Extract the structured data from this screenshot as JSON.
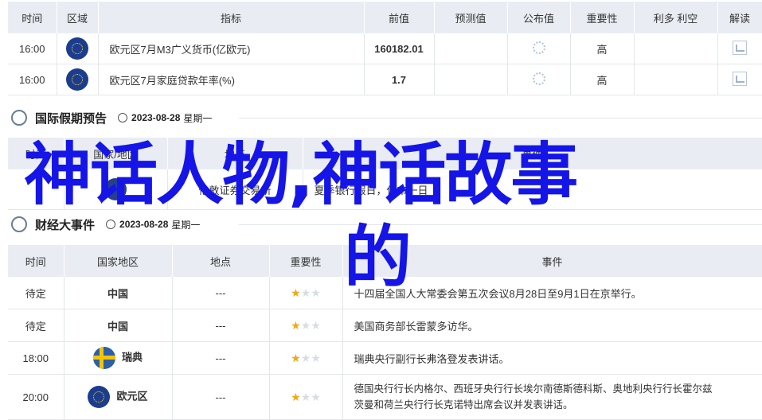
{
  "table1": {
    "headers": [
      "时间",
      "区域",
      "指标",
      "前值",
      "预测值",
      "公布值",
      "重要性",
      "利多 利空",
      "解读"
    ],
    "rows": [
      {
        "time": "16:00",
        "flag": "eu-flag",
        "indicator": "欧元区7月M3广义货币(亿欧元)",
        "prev": "160182.01",
        "importance": "高"
      },
      {
        "time": "16:00",
        "flag": "eu-flag",
        "indicator": "欧元区7月家庭贷款年率(%)",
        "prev": "1.7",
        "importance": "高"
      }
    ]
  },
  "holiday_section": {
    "title": "国际假期预告",
    "date": "2023-08-28",
    "weekday": "星期一",
    "headers": [
      "时间",
      "国家/地区",
      "地点",
      "事件"
    ],
    "row": {
      "place": "伦敦证券交易所",
      "event": "夏季银行假日，休市一日"
    }
  },
  "events_section": {
    "title": "财经大事件",
    "date": "2023-08-28",
    "weekday": "星期一",
    "headers": [
      "时间",
      "国家地区",
      "地点",
      "重要性",
      "事件"
    ],
    "rows": [
      {
        "time": "待定",
        "region": "中国",
        "place": "---",
        "stars": 1,
        "event": "十四届全国人大常委会第五次会议8月28日至9月1日在京举行。"
      },
      {
        "time": "待定",
        "region": "中国",
        "place": "---",
        "stars": 1,
        "event": "美国商务部长雷蒙多访华。"
      },
      {
        "time": "18:00",
        "region": "瑞典",
        "place": "---",
        "stars": 1,
        "event": "瑞典央行副行长弗洛登发表讲话。"
      },
      {
        "time": "20:00",
        "region": "欧元区",
        "place": "---",
        "stars": 1,
        "event_line1": "德国央行行长内格尔、西班牙央行行长埃尔南德斯德科斯、奥地利央行行长霍尔兹",
        "event_line2": "茨曼和荷兰央行行长克诺特出席会议并发表讲话。"
      }
    ]
  },
  "overlay": {
    "line1": "神话人物,神话故事",
    "line2": "的"
  },
  "colors": {
    "accent": "#d0021b",
    "overlay": "#1515e8",
    "header_bg": "#e9edf3",
    "star": "#f3a712"
  }
}
